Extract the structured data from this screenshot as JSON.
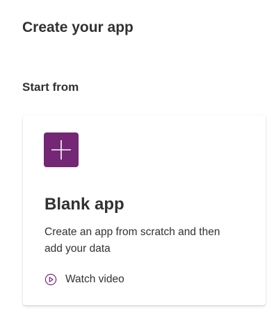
{
  "page": {
    "title": "Create your app"
  },
  "section": {
    "heading": "Start from"
  },
  "card": {
    "icon": "plus-icon",
    "icon_bg_color": "#742774",
    "title": "Blank app",
    "description": "Create an app from scratch and then add your data",
    "watch_label": "Watch video",
    "watch_icon": "play-circle-icon",
    "watch_icon_color": "#742774"
  }
}
